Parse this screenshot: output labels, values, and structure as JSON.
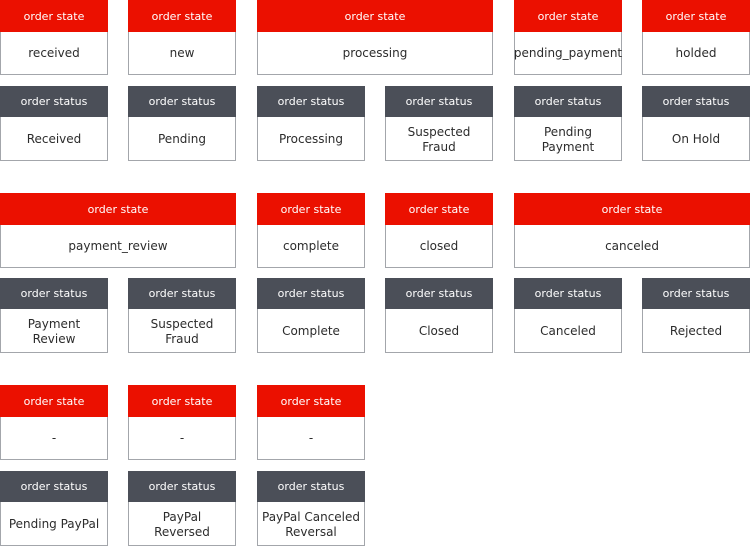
{
  "labels": {
    "state_header": "order state",
    "status_header": "order status"
  },
  "colors": {
    "state_header": "#eb1000",
    "status_header": "#4b4f58"
  },
  "groups": [
    {
      "states": [
        "received",
        "new",
        "processing",
        "pending_payment",
        "holded"
      ],
      "statuses": [
        "Received",
        "Pending",
        "Processing",
        "Suspected Fraud",
        "Pending Payment",
        "On Hold"
      ]
    },
    {
      "states": [
        "payment_review",
        "complete",
        "closed",
        "canceled"
      ],
      "statuses": [
        "Payment Review",
        "Suspected Fraud",
        "Complete",
        "Closed",
        "Canceled",
        "Rejected"
      ]
    },
    {
      "states": [
        "-",
        "-",
        "-"
      ],
      "statuses": [
        "Pending PayPal",
        "PayPal Reversed",
        "PayPal Canceled Reversal"
      ]
    }
  ]
}
